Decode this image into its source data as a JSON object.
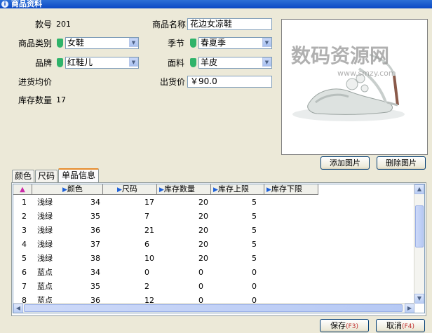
{
  "window": {
    "title": "商品资料"
  },
  "fields": {
    "code_label": "款号",
    "code_value": "201",
    "name_label": "商品名称",
    "name_value": "花边女凉鞋",
    "category_label": "商品类别",
    "category_value": "女鞋",
    "season_label": "季节",
    "season_value": "春夏季",
    "brand_label": "品牌",
    "brand_value": "红鞋儿",
    "material_label": "面料",
    "material_value": "羊皮",
    "avg_cost_label": "进货均价",
    "price_label": "出货价",
    "price_value": "￥90.0",
    "stock_label": "库存数量",
    "stock_value": "17"
  },
  "photo": {
    "add_label": "添加图片",
    "delete_label": "删除图片",
    "watermark": "数码资源网",
    "watermark_sub": "www.smzy.com"
  },
  "tabs": [
    {
      "label": "颜色"
    },
    {
      "label": "尺码"
    },
    {
      "label": "单品信息"
    }
  ],
  "table": {
    "headers": [
      "颜色",
      "尺码",
      "库存数量",
      "库存上限",
      "库存下限"
    ],
    "rows": [
      {
        "no": "1",
        "color": "浅绿",
        "size": "34",
        "qty": "17",
        "max": "20",
        "min": "5"
      },
      {
        "no": "2",
        "color": "浅绿",
        "size": "35",
        "qty": "7",
        "max": "20",
        "min": "5"
      },
      {
        "no": "3",
        "color": "浅绿",
        "size": "36",
        "qty": "21",
        "max": "20",
        "min": "5"
      },
      {
        "no": "4",
        "color": "浅绿",
        "size": "37",
        "qty": "6",
        "max": "20",
        "min": "5"
      },
      {
        "no": "5",
        "color": "浅绿",
        "size": "38",
        "qty": "10",
        "max": "20",
        "min": "5"
      },
      {
        "no": "6",
        "color": "蓝点",
        "size": "34",
        "qty": "0",
        "max": "0",
        "min": "0"
      },
      {
        "no": "7",
        "color": "蓝点",
        "size": "35",
        "qty": "2",
        "max": "0",
        "min": "0"
      },
      {
        "no": "8",
        "color": "蓝点",
        "size": "36",
        "qty": "12",
        "max": "0",
        "min": "0"
      }
    ]
  },
  "footer": {
    "save_label": "保存",
    "save_key": "(F3)",
    "cancel_label": "取消",
    "cancel_key": "(F4)"
  },
  "colors": {
    "title_bar": "#0a48c4",
    "dialog_bg": "#ece9d8",
    "combo_flag": "#2fb36a"
  }
}
